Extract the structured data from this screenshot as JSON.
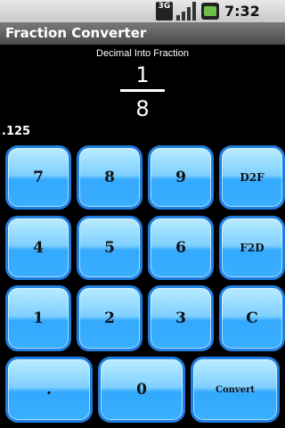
{
  "status_bar": {
    "network": "3G",
    "time": "7:32 AM"
  },
  "app": {
    "title": "Fraction Converter"
  },
  "display": {
    "mode_label": "Decimal Into Fraction",
    "numerator": "1",
    "denominator": "8",
    "decimal_input": ".125"
  },
  "keys": {
    "k7": "7",
    "k8": "8",
    "k9": "9",
    "d2f": "D2F",
    "k4": "4",
    "k5": "5",
    "k6": "6",
    "f2d": "F2D",
    "k1": "1",
    "k2": "2",
    "k3": "3",
    "clear": "C",
    "dot": ".",
    "k0": "0",
    "convert": "Convert"
  },
  "colors": {
    "key_top": "#b9ecff",
    "key_bottom": "#33a9ff",
    "key_border": "#1f7fe0",
    "background": "#000000"
  }
}
